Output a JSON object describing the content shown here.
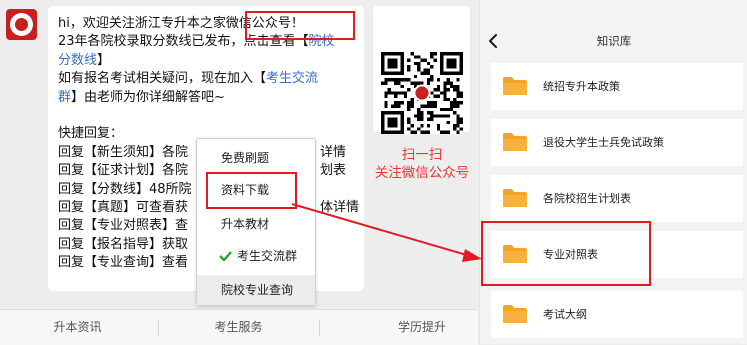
{
  "chat": {
    "messages": [
      [
        {
          "t": "hi，欢迎关注浙江专升本之家微信公众号！"
        }
      ],
      [
        {
          "t": "23年各院校录取分数线已发布，点击查看【"
        },
        {
          "t": "院校",
          "link": true
        }
      ],
      [
        {
          "t": "分数线",
          "link": true
        },
        {
          "t": "】"
        }
      ],
      [
        {
          "t": "如有报名考试相关疑问，现在加入【"
        },
        {
          "t": "考生交流",
          "link": true
        }
      ],
      [
        {
          "t": "群",
          "link": true
        },
        {
          "t": "】由老师为你详细解答吧~"
        }
      ],
      [
        {
          "t": ""
        }
      ],
      [
        {
          "t": "快捷回复："
        }
      ],
      [
        {
          "t": "回复【新生须知】各院"
        },
        {
          "t": "详情",
          "gap": true
        }
      ],
      [
        {
          "t": "回复【征求计划】各院"
        },
        {
          "t": "划表",
          "gap": true
        }
      ],
      [
        {
          "t": "回复【分数线】48所院"
        }
      ],
      [
        {
          "t": "回复【真题】可查看获"
        },
        {
          "t": "体详情",
          "gap": true
        }
      ],
      [
        {
          "t": "回复【专业对照表】查"
        }
      ],
      [
        {
          "t": "回复【报名指导】获取"
        }
      ],
      [
        {
          "t": "回复【专业查询】查看"
        }
      ]
    ],
    "scan_caption": [
      "扫一扫",
      "关注微信公众号"
    ],
    "popup_menu": [
      {
        "label": "免费刷题"
      },
      {
        "label": "资料下载"
      },
      {
        "label": "升本教材"
      },
      {
        "label": "考生交流群",
        "check": true
      },
      {
        "label": "院校专业查询",
        "selected": true
      }
    ],
    "bottom_tabs": [
      "升本资讯",
      "考生服务",
      "学历提升"
    ]
  },
  "kb": {
    "title": "知识库",
    "items": [
      "统招专升本政策",
      "退役大学生士兵免试政策",
      "各院校招生计划表",
      "专业对照表",
      "考试大纲"
    ]
  },
  "colors": {
    "annotation": "#e11b22",
    "link": "#3b6fbb",
    "folder": "#f6b23d",
    "check": "#2aa52a"
  }
}
